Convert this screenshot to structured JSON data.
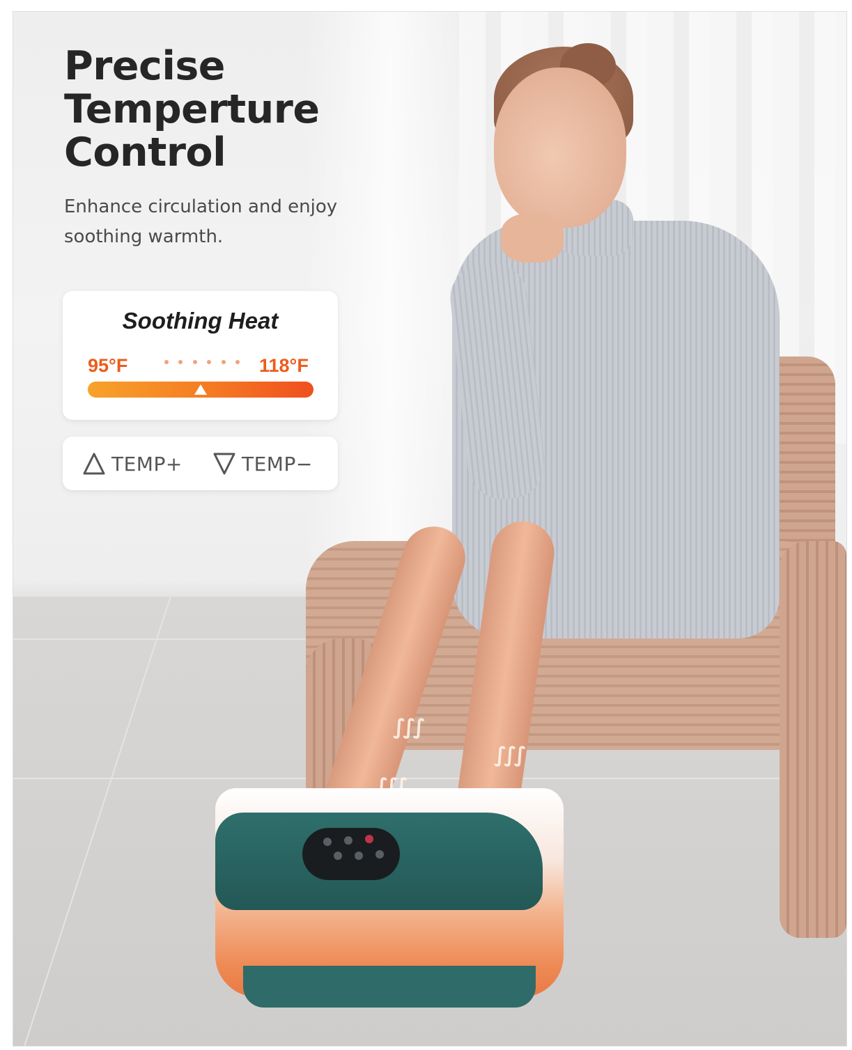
{
  "headline": {
    "line1": "Precise",
    "line2": "Temperture",
    "line3": "Control"
  },
  "subtext": "Enhance circulation and enjoy soothing warmth.",
  "heat_card": {
    "title": "Soothing Heat",
    "min_label": "95°F",
    "max_label": "118°F",
    "range_min": 95,
    "range_max": 118,
    "current_fraction": 0.5,
    "gradient_colors": [
      "#f7a22a",
      "#f57a23",
      "#ef4f1e"
    ]
  },
  "buttons": {
    "increase": {
      "icon": "triangle-up-outline-icon",
      "label": "TEMP+"
    },
    "decrease": {
      "icon": "triangle-down-outline-icon",
      "label": "TEMP−"
    }
  },
  "colors": {
    "accent_orange": "#ec5d1c",
    "headline": "#262626",
    "device_teal": "#2f6f6c"
  }
}
